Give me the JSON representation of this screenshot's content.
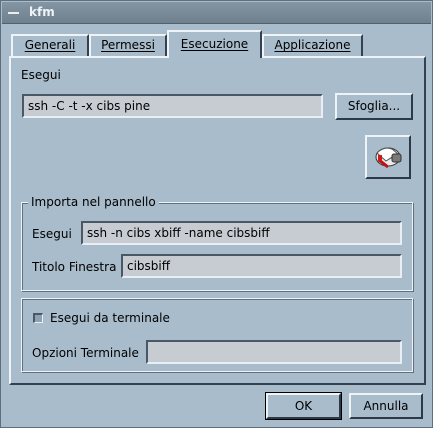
{
  "window": {
    "title": "kfm"
  },
  "tabs": [
    {
      "label": "Generali"
    },
    {
      "label": "Permessi"
    },
    {
      "label": "Esecuzione"
    },
    {
      "label": "Applicazione"
    }
  ],
  "execute": {
    "label": "Esegui",
    "command_value": "ssh -C -t -x cibs pine",
    "browse_button": "Sfoglia...",
    "icon_name": "mail-icon"
  },
  "import_group": {
    "title": "Importa nel pannello",
    "exec_label": "Esegui",
    "exec_value": "ssh -n cibs xbiff -name cibsbiff",
    "window_title_label": "Titolo Finestra",
    "window_title_value": "cibsbiff"
  },
  "terminal_group": {
    "run_in_terminal_label": "Esegui da terminale",
    "run_in_terminal_checked": false,
    "terminal_options_label": "Opzioni Terminale",
    "terminal_options_value": ""
  },
  "footer": {
    "ok_button": "OK",
    "cancel_button": "Annulla"
  },
  "colors": {
    "window_bg": "#a9bccb",
    "titlebar": "#7a8b99",
    "field_bg": "#c6ccd2"
  }
}
